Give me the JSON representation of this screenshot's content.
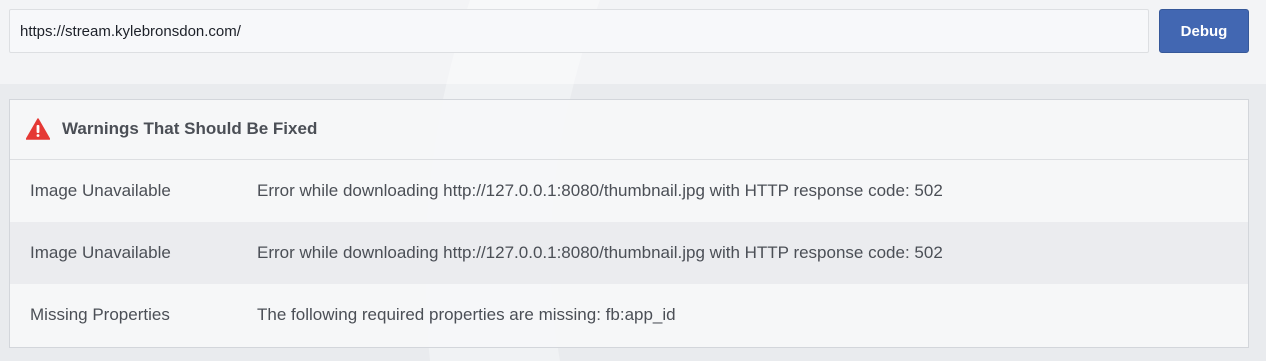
{
  "url_input": {
    "value": "https://stream.kylebronsdon.com/"
  },
  "debug_button": {
    "label": "Debug"
  },
  "warnings_panel": {
    "icon": "warning-triangle-icon",
    "title": "Warnings That Should Be Fixed",
    "rows": [
      {
        "label": "Image Unavailable",
        "message": "Error while downloading http://127.0.0.1:8080/thumbnail.jpg with HTTP response code: 502"
      },
      {
        "label": "Image Unavailable",
        "message": "Error while downloading http://127.0.0.1:8080/thumbnail.jpg with HTTP response code: 502"
      },
      {
        "label": "Missing Properties",
        "message": "The following required properties are missing: fb:app_id"
      }
    ]
  },
  "colors": {
    "accent": "#4267b2",
    "warning": "#e53935",
    "text": "#4b4f56"
  }
}
